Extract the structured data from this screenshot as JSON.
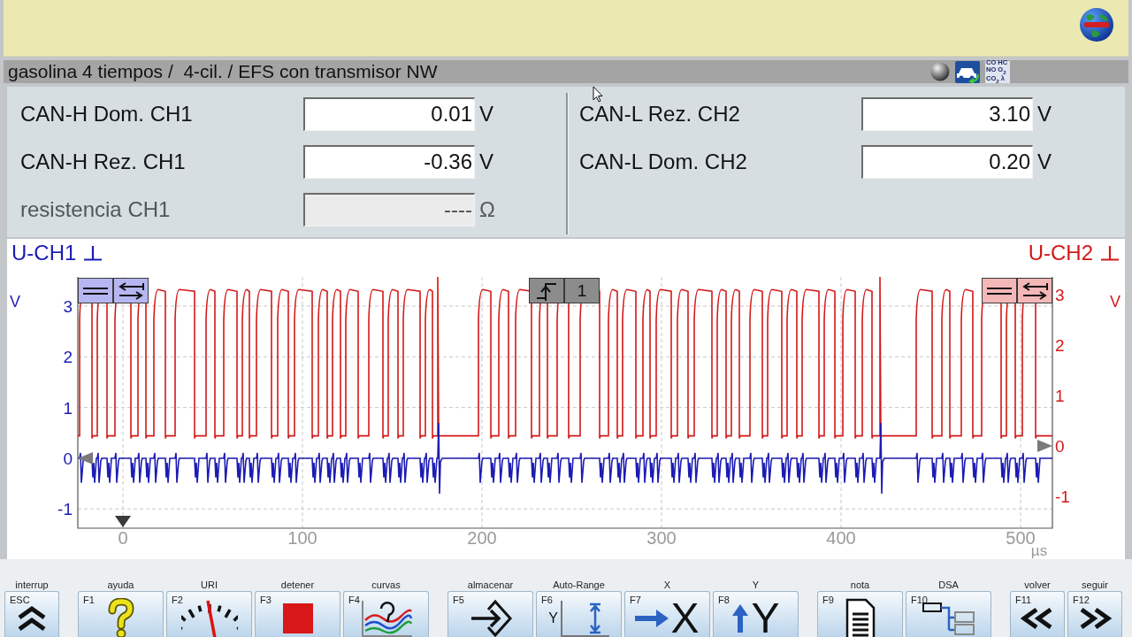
{
  "breadcrumb": "gasolina 4 tiempos /  4-cil. / EFS con transmisor NW",
  "status_icons": {
    "gas_labels": [
      "CO HC",
      "NO O$_{2}$",
      "CO$_{2}$ λ"
    ]
  },
  "measurements": {
    "left": [
      {
        "label": "CAN-H Dom. CH1",
        "value": "0.01",
        "unit": "V",
        "disabled": false
      },
      {
        "label": "CAN-H Rez. CH1",
        "value": "-0.36",
        "unit": "V",
        "disabled": false
      },
      {
        "label": "resistencia CH1",
        "value": "----",
        "unit": "Ω",
        "disabled": true
      }
    ],
    "right": [
      {
        "label": "CAN-L Rez. CH2",
        "value": "3.10",
        "unit": "V",
        "disabled": false
      },
      {
        "label": "CAN-L Dom. CH2",
        "value": "0.20",
        "unit": "V",
        "disabled": false
      }
    ]
  },
  "scope": {
    "channels": [
      {
        "title": "U-CH1",
        "unit": "V",
        "color": "#1c1cb4",
        "ticks": [
          "3",
          "2",
          "1",
          "0",
          "-1"
        ]
      },
      {
        "title": "U-CH2",
        "unit": "V",
        "color": "#d41818",
        "ticks": [
          "3",
          "2",
          "1",
          "0",
          "-1"
        ]
      }
    ],
    "x_ticks": [
      "0",
      "100",
      "200",
      "300",
      "400",
      "500"
    ],
    "x_unit": "µs",
    "trigger_label": "1"
  },
  "function_keys": [
    [
      {
        "caption": "interrup",
        "key": "ESC",
        "kind": "chevrons-up"
      }
    ],
    [
      {
        "caption": "ayuda",
        "key": "F1",
        "kind": "help"
      },
      {
        "caption": "URI",
        "key": "F2",
        "kind": "gauge"
      },
      {
        "caption": "detener",
        "key": "F3",
        "kind": "stop"
      },
      {
        "caption": "curvas",
        "key": "F4",
        "kind": "curves"
      }
    ],
    [
      {
        "caption": "almacenar",
        "key": "F5",
        "kind": "store"
      },
      {
        "caption": "Auto-Range",
        "key": "F6",
        "kind": "auto-range",
        "glyph": "Y"
      },
      {
        "caption": "X",
        "key": "F7",
        "kind": "arrow-right",
        "glyph": "X"
      },
      {
        "caption": "Y",
        "key": "F8",
        "kind": "arrow-up",
        "glyph": "Y"
      }
    ],
    [
      {
        "caption": "nota",
        "key": "F9",
        "kind": "document"
      },
      {
        "caption": "DSA",
        "key": "F10",
        "kind": "dsa"
      }
    ],
    [
      {
        "caption": "volver",
        "key": "F11",
        "kind": "chevrons-left"
      },
      {
        "caption": "seguir",
        "key": "F12",
        "kind": "chevrons-right"
      }
    ]
  ]
}
